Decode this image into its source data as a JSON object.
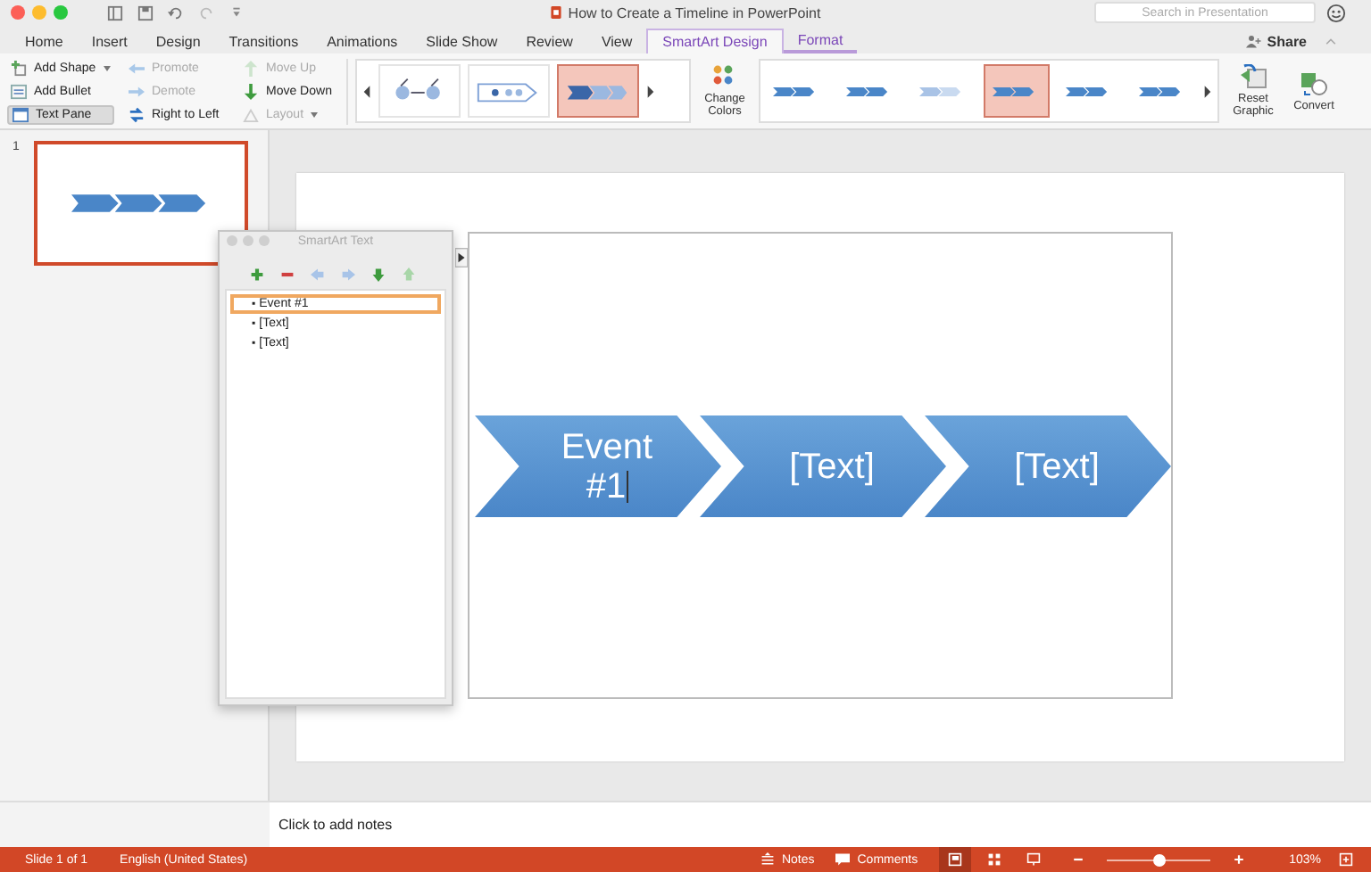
{
  "window": {
    "title": "How to Create a Timeline in PowerPoint"
  },
  "search": {
    "placeholder": "Search in Presentation"
  },
  "tabs": [
    {
      "label": "Home",
      "selected": false,
      "contextual": false
    },
    {
      "label": "Insert",
      "selected": false,
      "contextual": false
    },
    {
      "label": "Design",
      "selected": false,
      "contextual": false
    },
    {
      "label": "Transitions",
      "selected": false,
      "contextual": false
    },
    {
      "label": "Animations",
      "selected": false,
      "contextual": false
    },
    {
      "label": "Slide Show",
      "selected": false,
      "contextual": false
    },
    {
      "label": "Review",
      "selected": false,
      "contextual": false
    },
    {
      "label": "View",
      "selected": false,
      "contextual": false
    },
    {
      "label": "SmartArt Design",
      "selected": true,
      "contextual": true
    },
    {
      "label": "Format",
      "selected": false,
      "contextual": true
    }
  ],
  "share": {
    "label": "Share"
  },
  "ribbon": {
    "columns": [
      [
        {
          "label": "Add Shape",
          "kind": "add-shape",
          "disabled": false,
          "on": false,
          "dropdown": true
        },
        {
          "label": "Add Bullet",
          "kind": "add-bullet",
          "disabled": false,
          "on": false,
          "dropdown": false
        },
        {
          "label": "Text Pane",
          "kind": "text-pane",
          "disabled": false,
          "on": true,
          "dropdown": false
        }
      ],
      [
        {
          "label": "Promote",
          "kind": "promote",
          "disabled": true,
          "on": false,
          "dropdown": false
        },
        {
          "label": "Demote",
          "kind": "demote",
          "disabled": true,
          "on": false,
          "dropdown": false
        },
        {
          "label": "Right to Left",
          "kind": "right-to-left",
          "disabled": false,
          "on": false,
          "dropdown": false
        }
      ],
      [
        {
          "label": "Move Up",
          "kind": "move-up",
          "disabled": true,
          "on": false,
          "dropdown": false
        },
        {
          "label": "Move Down",
          "kind": "move-down",
          "disabled": false,
          "on": false,
          "dropdown": false
        },
        {
          "label": "Layout",
          "kind": "layout",
          "disabled": true,
          "on": false,
          "dropdown": true
        }
      ]
    ],
    "layouts": [
      {
        "selected": false
      },
      {
        "selected": false
      },
      {
        "selected": true
      }
    ],
    "change_colors": {
      "label": "Change Colors"
    },
    "styles": [
      {
        "selected": false
      },
      {
        "selected": false
      },
      {
        "selected": false
      },
      {
        "selected": true
      },
      {
        "selected": false
      },
      {
        "selected": false
      }
    ],
    "reset_graphic": {
      "label": "Reset Graphic"
    },
    "convert": {
      "label": "Convert"
    }
  },
  "slides": [
    {
      "number": "1",
      "selected": true
    }
  ],
  "text_pane": {
    "title": "SmartArt Text",
    "items": [
      {
        "marker": "▪",
        "text": "Event #1",
        "selected": true
      },
      {
        "marker": "▪",
        "text": "[Text]",
        "selected": false
      },
      {
        "marker": "▪",
        "text": "[Text]",
        "selected": false
      }
    ]
  },
  "smartart": {
    "shapes": [
      "Event #1",
      "[Text]",
      "[Text]"
    ]
  },
  "notes": {
    "placeholder": "Click to add notes"
  },
  "status_bar": {
    "slide": "Slide 1 of 1",
    "language": "English (United States)",
    "notes": "Notes",
    "comments": "Comments",
    "views": [
      {
        "selected": true
      },
      {
        "selected": false
      },
      {
        "selected": false
      }
    ],
    "zoom": {
      "level": 0.49,
      "reading": "103%"
    }
  }
}
